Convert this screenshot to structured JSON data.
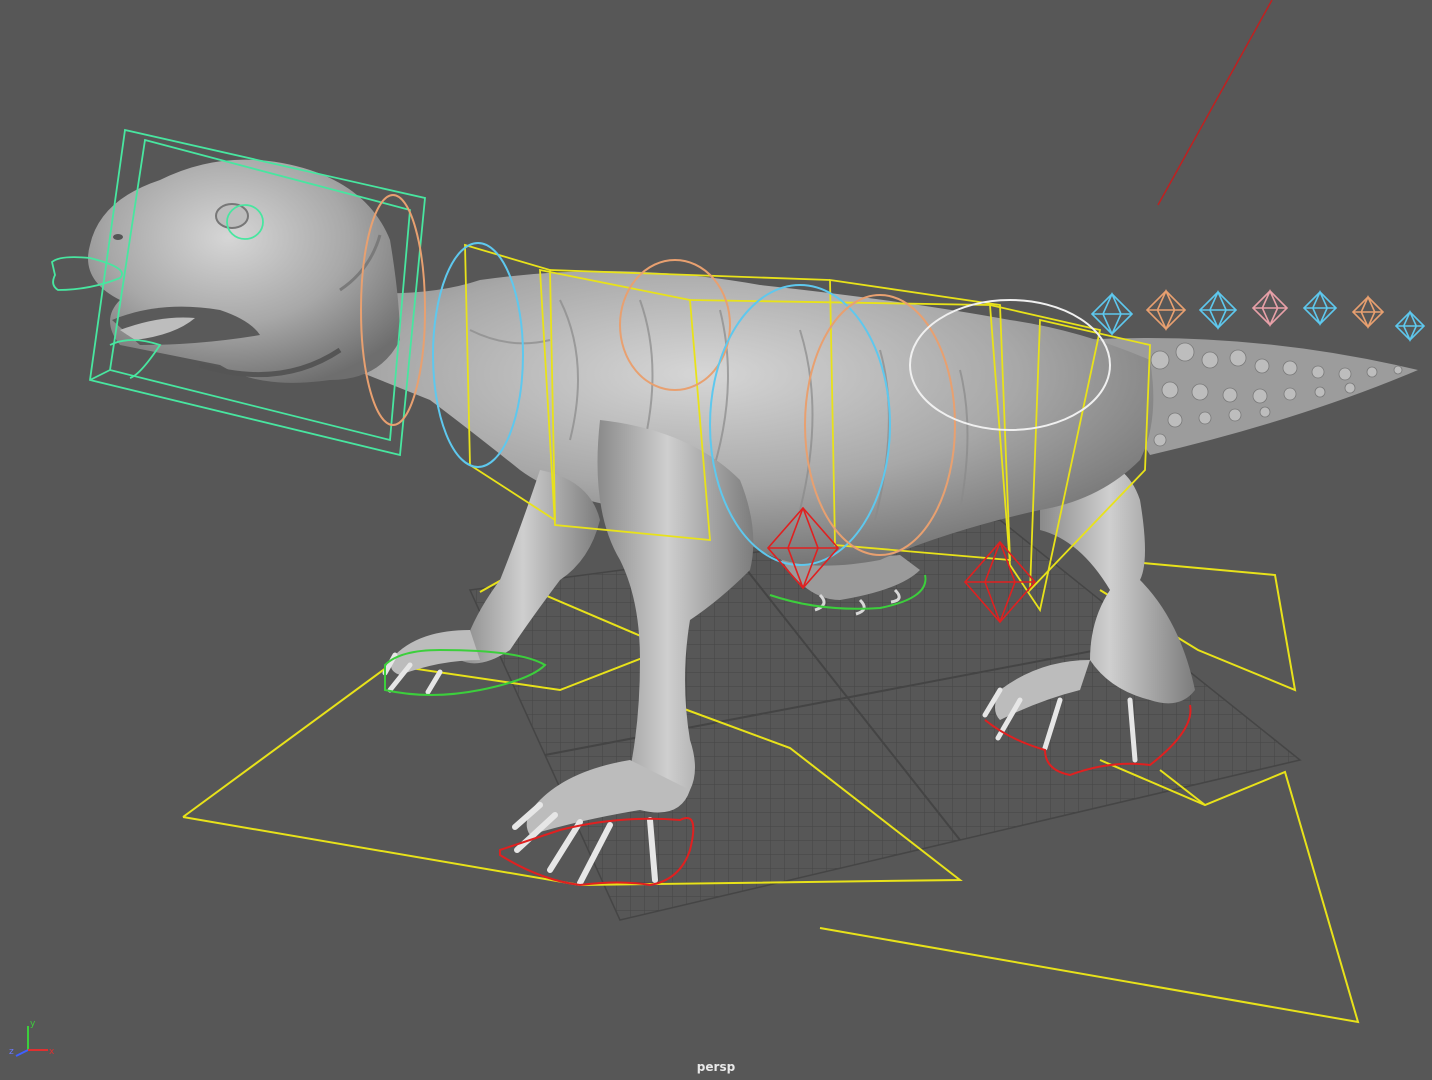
{
  "viewport": {
    "camera_name": "persp"
  },
  "axis_gizmo": {
    "x_label": "x",
    "y_label": "y",
    "z_label": "z",
    "x_color": "#e03030",
    "y_color": "#3ccf3c",
    "z_color": "#4060ff"
  },
  "colors": {
    "background": "#575757",
    "mesh": "#a9a9a9",
    "mesh_shadow": "#6f6f6f",
    "mesh_highlight": "#d4d4d4",
    "grid": "#3f3f3f",
    "control_yellow": "#e8e21a",
    "control_green": "#48e6a0",
    "control_cyan": "#5ec8ee",
    "control_orange": "#e8a070",
    "control_white": "#f0f0f0",
    "control_red": "#e02020",
    "control_pink": "#e8a0a8",
    "light_line": "#c02020"
  },
  "tail_controls": [
    {
      "color": "#5ec8ee"
    },
    {
      "color": "#e8a070"
    },
    {
      "color": "#5ec8ee"
    },
    {
      "color": "#e8a0a8"
    },
    {
      "color": "#5ec8ee"
    },
    {
      "color": "#e8a070"
    },
    {
      "color": "#5ec8ee"
    }
  ]
}
